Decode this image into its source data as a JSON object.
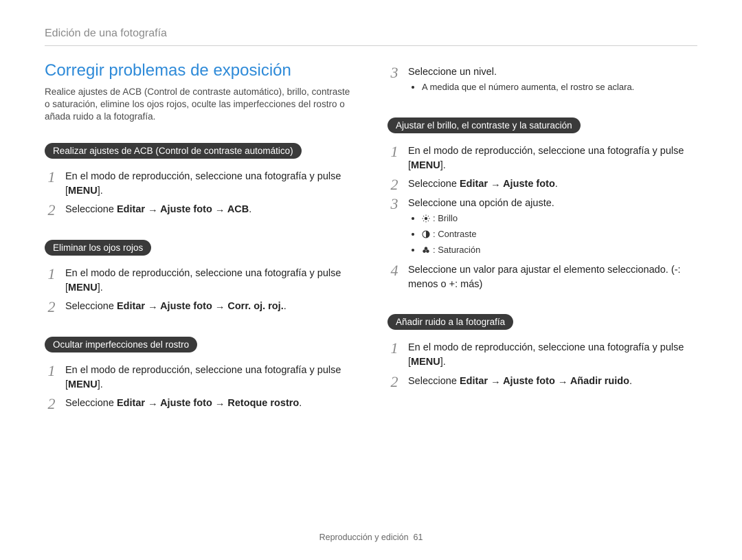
{
  "header": "Edición de una fotografía",
  "left": {
    "title": "Corregir problemas de exposición",
    "intro": "Realice ajustes de ACB (Control de contraste automático), brillo, contraste o saturación, elimine los ojos rojos, oculte las imperfecciones del rostro o añada ruido a la fotografía.",
    "acb": {
      "pill": "Realizar ajustes de ACB (Control de contraste automático)",
      "step1_a": "En el modo de reproducción, seleccione una fotografía y pulse [",
      "step1_b": "MENU",
      "step1_c": "].",
      "step2_a": "Seleccione ",
      "step2_b": "Editar → Ajuste foto → ACB",
      "step2_c": "."
    },
    "redeye": {
      "pill": "Eliminar los ojos rojos",
      "step1_a": "En el modo de reproducción, seleccione una fotografía y pulse [",
      "step1_b": "MENU",
      "step1_c": "].",
      "step2_a": "Seleccione ",
      "step2_b": "Editar → Ajuste foto → Corr. oj. roj.",
      "step2_c": "."
    },
    "face": {
      "pill": "Ocultar imperfecciones del rostro",
      "step1_a": "En el modo de reproducción, seleccione una fotografía y pulse [",
      "step1_b": "MENU",
      "step1_c": "].",
      "step2_a": "Seleccione ",
      "step2_b": "Editar → Ajuste foto → Retoque rostro",
      "step2_c": "."
    }
  },
  "right": {
    "face_cont": {
      "step3": "Seleccione un nivel.",
      "bullet1": "A medida que el número aumenta, el rostro se aclara."
    },
    "bcs": {
      "pill": "Ajustar el brillo, el contraste y la saturación",
      "step1_a": "En el modo de reproducción, seleccione una fotografía y pulse [",
      "step1_b": "MENU",
      "step1_c": "].",
      "step2_a": "Seleccione ",
      "step2_b": "Editar → Ajuste foto",
      "step2_c": ".",
      "step3": "Seleccione una opción de ajuste.",
      "opt_brillo": ": Brillo",
      "opt_contraste": ": Contraste",
      "opt_saturacion": ": Saturación",
      "step4": "Seleccione un valor para ajustar el elemento seleccionado. (-: menos o +: más)"
    },
    "noise": {
      "pill": "Añadir ruido a la fotografía",
      "step1_a": "En el modo de reproducción, seleccione una fotografía y pulse [",
      "step1_b": "MENU",
      "step1_c": "].",
      "step2_a": "Seleccione ",
      "step2_b": "Editar → Ajuste foto → Añadir ruido",
      "step2_c": "."
    }
  },
  "footer_text": "Reproducción y edición",
  "footer_page": "61"
}
